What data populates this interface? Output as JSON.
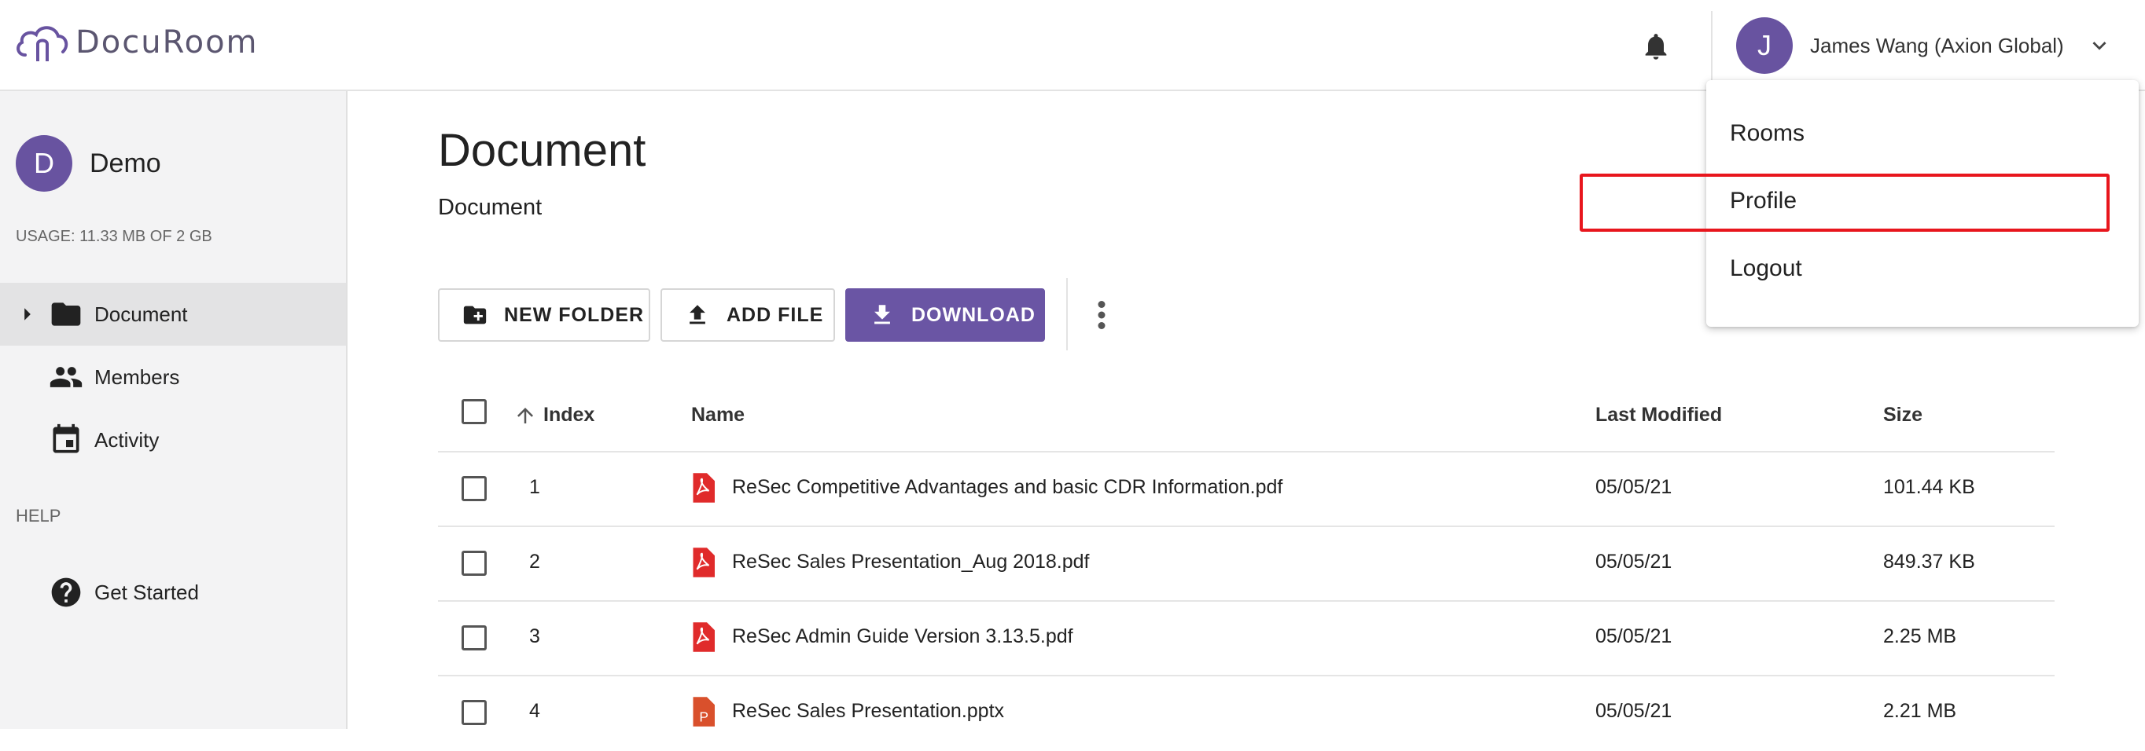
{
  "app": {
    "name": "DocuRoom"
  },
  "header": {
    "notifications_icon": "bell-icon",
    "user": {
      "initial": "J",
      "name": "James Wang (Axion Global)"
    }
  },
  "user_menu": {
    "items": [
      "Rooms",
      "Profile",
      "Logout"
    ],
    "highlighted": "Profile",
    "highlight_color": "#e8161d"
  },
  "sidebar": {
    "room": {
      "initial": "D",
      "name": "Demo"
    },
    "usage": "USAGE: 11.33 MB OF 2 GB",
    "nav": [
      {
        "label": "Document",
        "icon": "folder-icon",
        "active": true
      },
      {
        "label": "Members",
        "icon": "people-icon",
        "active": false
      },
      {
        "label": "Activity",
        "icon": "calendar-icon",
        "active": false
      }
    ],
    "help_label": "HELP",
    "help_items": [
      {
        "label": "Get Started",
        "icon": "help-circle-icon"
      }
    ]
  },
  "main": {
    "title": "Document",
    "breadcrumb": "Document",
    "toolbar": {
      "new_folder": "NEW FOLDER",
      "add_file": "ADD FILE",
      "download": "DOWNLOAD"
    },
    "table": {
      "columns": [
        "Index",
        "Name",
        "Last Modified",
        "Size"
      ],
      "sort": {
        "column": "Index",
        "direction": "ascending"
      },
      "rows": [
        {
          "index": "1",
          "name": "ReSec Competitive Advantages and basic CDR Information.pdf",
          "type": "pdf",
          "modified": "05/05/21",
          "size": "101.44 KB"
        },
        {
          "index": "2",
          "name": "ReSec Sales Presentation_Aug 2018.pdf",
          "type": "pdf",
          "modified": "05/05/21",
          "size": "849.37 KB"
        },
        {
          "index": "3",
          "name": "ReSec Admin Guide Version 3.13.5.pdf",
          "type": "pdf",
          "modified": "05/05/21",
          "size": "2.25 MB"
        },
        {
          "index": "4",
          "name": "ReSec Sales Presentation.pptx",
          "type": "pptx",
          "modified": "05/05/21",
          "size": "2.21 MB"
        }
      ]
    }
  },
  "colors": {
    "accent": "#6853a0",
    "pdf_icon": "#e02b2b",
    "pptx_icon": "#d9502c"
  }
}
